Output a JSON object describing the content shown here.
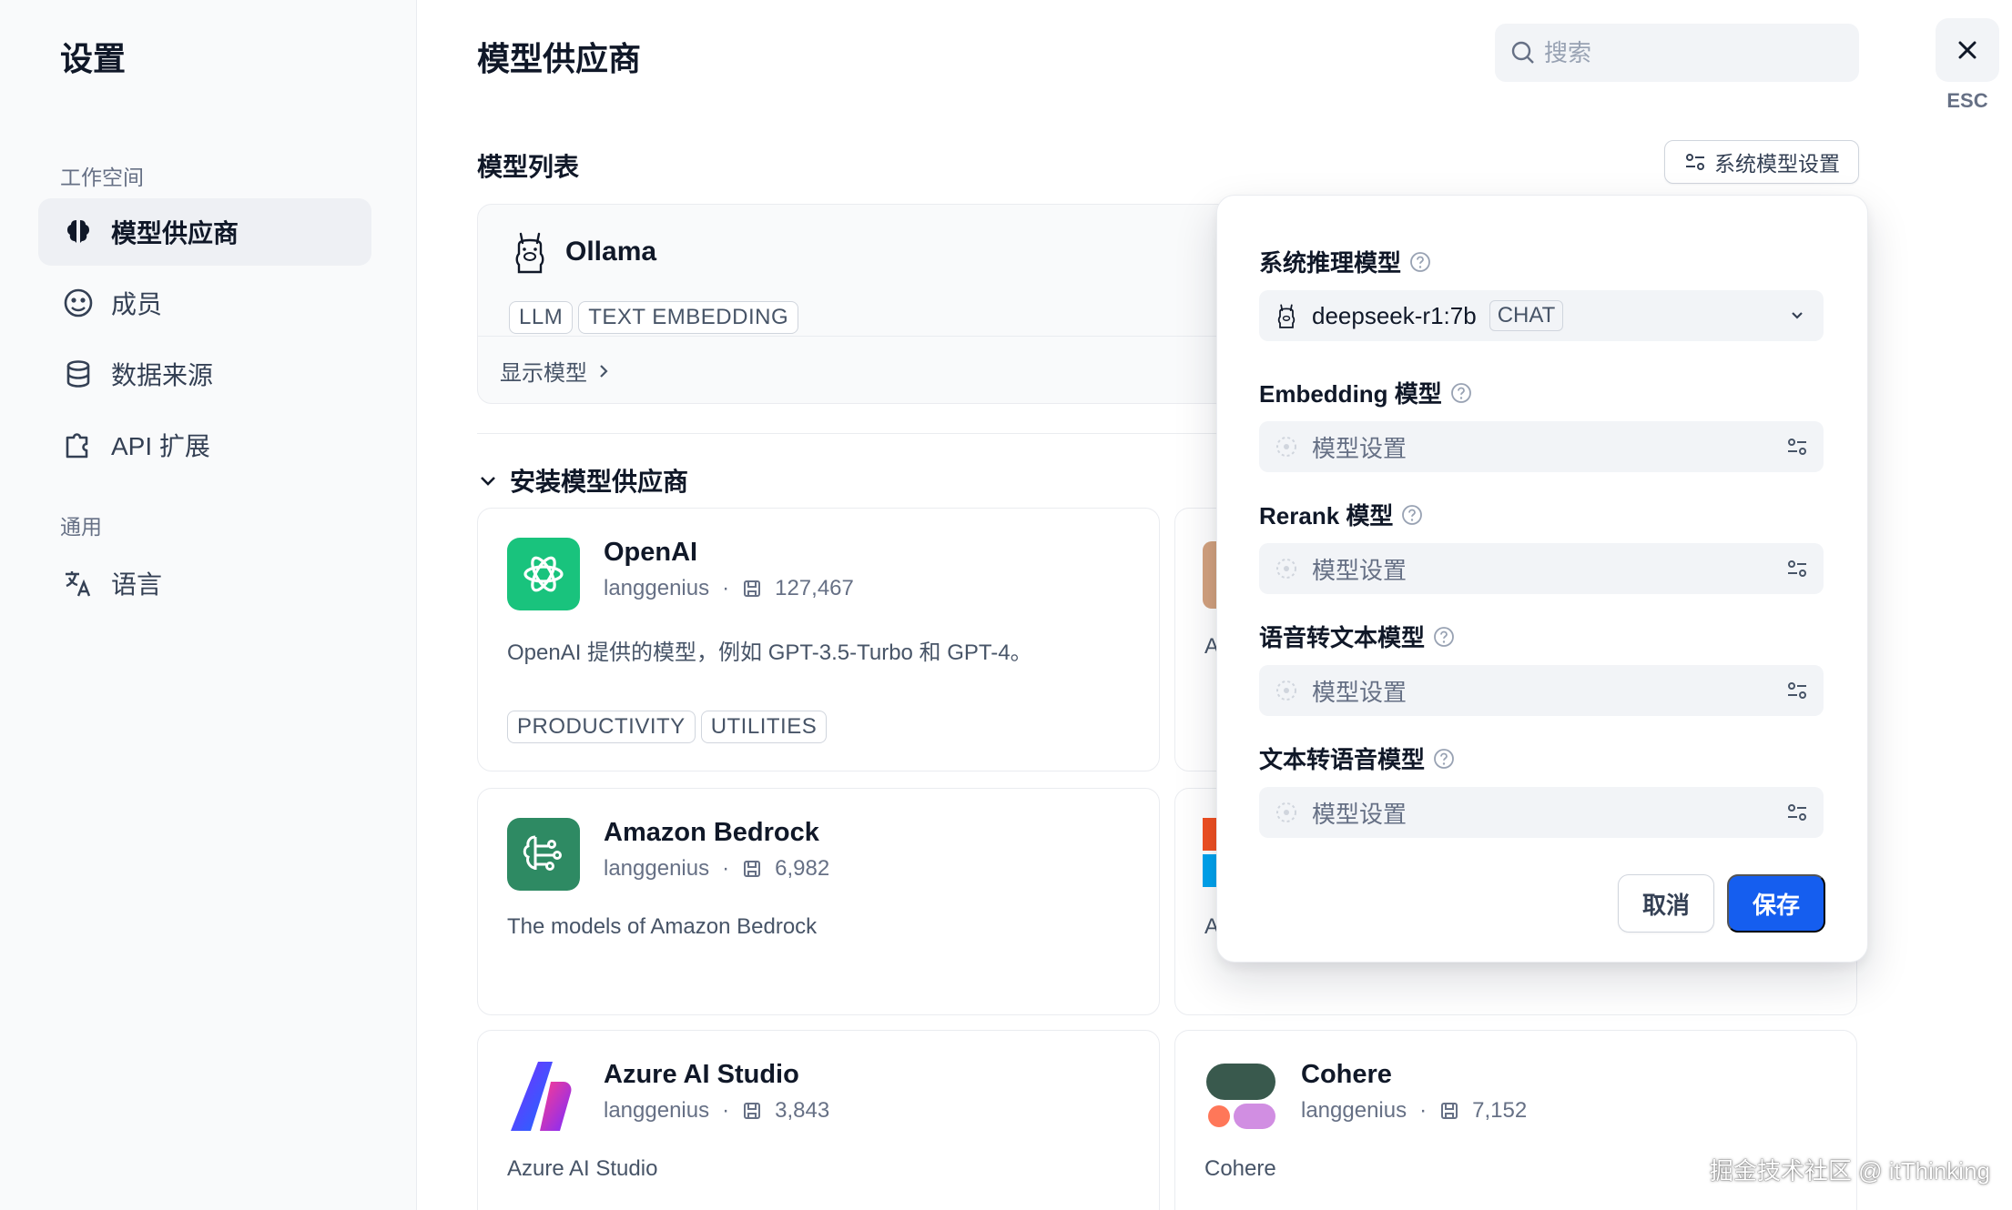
{
  "sidebar": {
    "title": "设置",
    "workspace_label": "工作空间",
    "general_label": "通用",
    "items": [
      {
        "label": "模型供应商",
        "icon": "brain-icon"
      },
      {
        "label": "成员",
        "icon": "members-icon"
      },
      {
        "label": "数据来源",
        "icon": "database-icon"
      },
      {
        "label": "API 扩展",
        "icon": "puzzle-icon"
      }
    ],
    "general_items": [
      {
        "label": "语言",
        "icon": "translate-icon"
      }
    ]
  },
  "header": {
    "title": "模型供应商",
    "search_placeholder": "搜索",
    "esc_label": "ESC"
  },
  "model_list": {
    "title": "模型列表",
    "system_settings_button": "系统模型设置",
    "ollama": {
      "name": "Ollama",
      "tags": [
        "LLM",
        "TEXT EMBEDDING"
      ],
      "show_models": "显示模型"
    }
  },
  "install": {
    "title": "安装模型供应商",
    "providers": [
      {
        "name": "OpenAI",
        "author": "langgenius",
        "installs": "127,467",
        "desc": "OpenAI 提供的模型，例如 GPT-3.5-Turbo 和 GPT-4。",
        "tags": [
          "PRODUCTIVITY",
          "UTILITIES"
        ]
      },
      {
        "name": "Amazon Bedrock",
        "author": "langgenius",
        "installs": "6,982",
        "desc": "The models of Amazon Bedrock"
      },
      {
        "name": "Azure AI Studio",
        "author": "langgenius",
        "installs": "3,843",
        "desc": "Azure AI Studio"
      },
      {
        "name": "Cohere",
        "author": "langgenius",
        "installs": "7,152",
        "desc": "Cohere"
      }
    ],
    "partial_letter": "A"
  },
  "popup": {
    "reasoning_label": "系统推理模型",
    "reasoning_value": "deepseek-r1:7b",
    "reasoning_tag": "CHAT",
    "embedding_label": "Embedding 模型",
    "rerank_label": "Rerank 模型",
    "stt_label": "语音转文本模型",
    "tts_label": "文本转语音模型",
    "placeholder": "模型设置",
    "cancel": "取消",
    "save": "保存"
  },
  "colors": {
    "primary": "#155eef",
    "openai": "#19c37d",
    "bedrock": "#2e8a63"
  },
  "watermark": "掘金技术社区 @ itThinking"
}
